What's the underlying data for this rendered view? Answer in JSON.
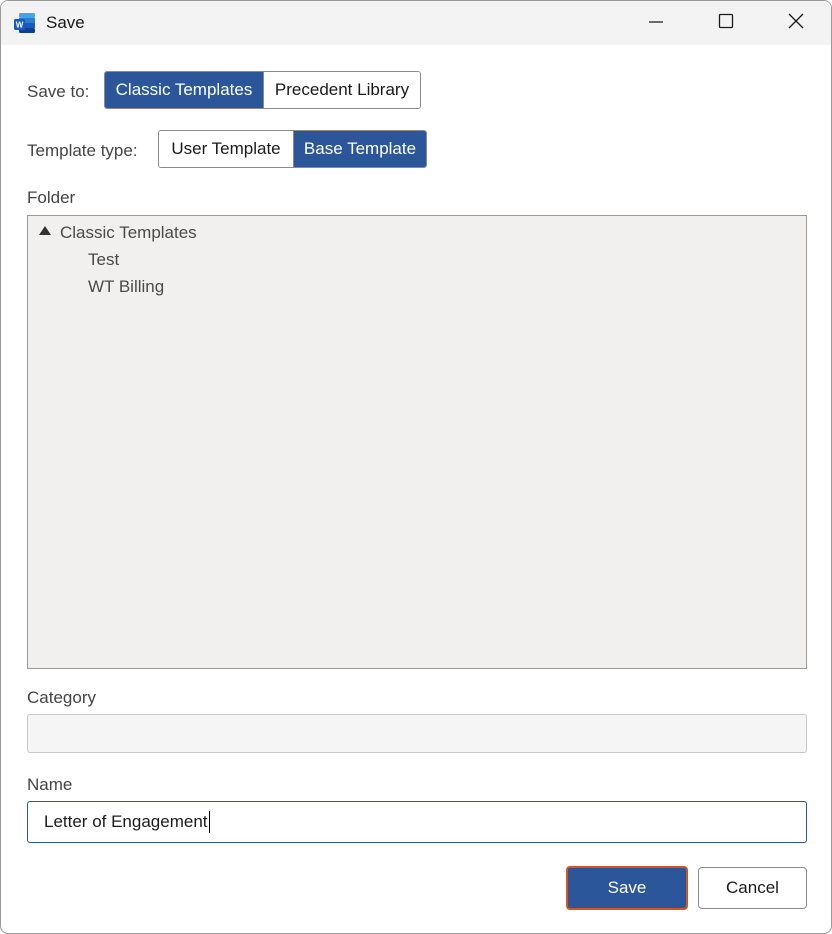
{
  "window": {
    "title": "Save",
    "app_icon": "word-icon",
    "controls": [
      "minimize-icon",
      "maximize-icon",
      "close-icon"
    ]
  },
  "save_to": {
    "label": "Save to:",
    "options": [
      {
        "label": "Classic Templates",
        "selected": true
      },
      {
        "label": "Precedent Library",
        "selected": false
      }
    ]
  },
  "template_type": {
    "label": "Template type:",
    "options": [
      {
        "label": "User Template",
        "selected": false
      },
      {
        "label": "Base Template",
        "selected": true
      }
    ]
  },
  "folder": {
    "label": "Folder",
    "tree": {
      "root": {
        "label": "Classic Templates",
        "expanded": true
      },
      "children": [
        {
          "label": "Test"
        },
        {
          "label": "WT Billing"
        }
      ]
    }
  },
  "category": {
    "label": "Category",
    "value": ""
  },
  "name": {
    "label": "Name",
    "value": "Letter of Engagement"
  },
  "actions": {
    "save_label": "Save",
    "cancel_label": "Cancel"
  },
  "colors": {
    "accent": "#2b579a",
    "focus_border": "#d4541f",
    "tree_background": "#f1f0ee"
  }
}
